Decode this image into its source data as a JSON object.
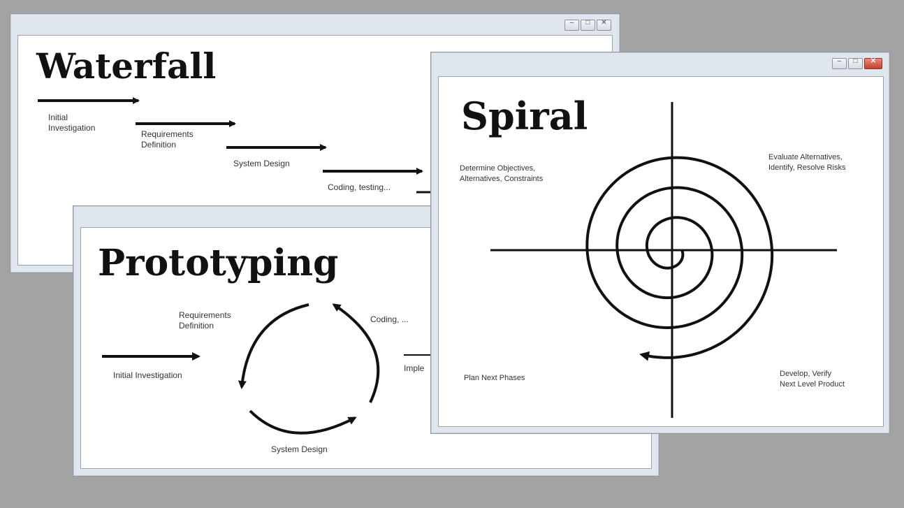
{
  "windows": {
    "waterfall": {
      "title": "Waterfall",
      "steps": [
        "Initial\nInvestigation",
        "Requirements\nDefinition",
        "System Design",
        "Coding, testing..."
      ]
    },
    "prototyping": {
      "title": "Prototyping",
      "labels": {
        "requirements": "Requirements\nDefinition",
        "coding": "Coding, ...",
        "initial": "Initial Investigation",
        "system_design": "System Design",
        "implementation_partial": "Imple"
      }
    },
    "spiral": {
      "title": "Spiral",
      "quadrants": {
        "top_left": "Determine Objectives,\nAlternatives, Constraints",
        "top_right": "Evaluate Alternatives,\nIdentify, Resolve Risks",
        "bottom_left": "Plan Next Phases",
        "bottom_right": "Develop, Verify\nNext Level Product"
      }
    }
  },
  "icons": {
    "window_controls": [
      "minimize-icon",
      "maximize-icon",
      "close-icon"
    ]
  },
  "colors": {
    "background": "#a3a3a3",
    "window_frame": "#dfe6ee",
    "close_button": "#c7402c"
  }
}
